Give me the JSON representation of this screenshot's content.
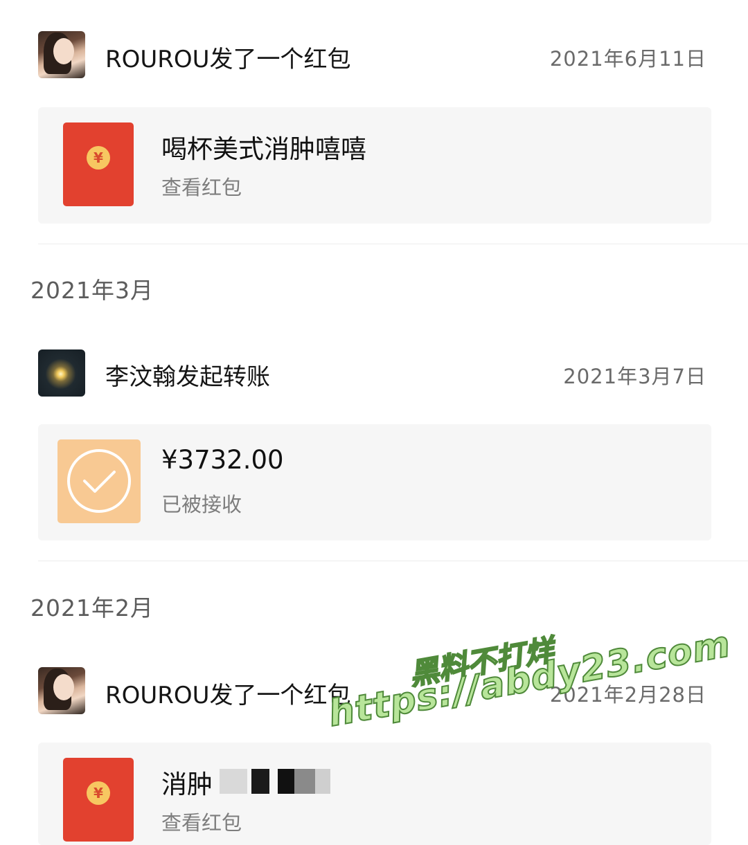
{
  "transactions": [
    {
      "sender": "ROUROU发了一个红包",
      "date": "2021年6月11日",
      "avatar": "female-portrait-avatar",
      "card_type": "red-packet",
      "card_title": "喝杯美式消肿嘻嘻",
      "card_subtitle": "查看红包"
    },
    {
      "sender": "李汶翰发起转账",
      "date": "2021年3月7日",
      "avatar": "night-sky-moon-avatar",
      "card_type": "transfer",
      "card_title": "¥3732.00",
      "card_subtitle": "已被接收"
    },
    {
      "sender": "ROUROU发了一个红包",
      "date": "2021年2月28日",
      "avatar": "female-portrait-avatar",
      "card_type": "red-packet",
      "card_title": "消肿",
      "card_subtitle": "查看红包"
    }
  ],
  "month_headers": [
    "2021年3月",
    "2021年2月"
  ],
  "red_packet_symbol": "¥",
  "watermark": {
    "line1": "黑料不打烊",
    "line2": "https://abdy23.com"
  },
  "colors": {
    "red_packet": "#e2412f",
    "coin": "#f7c761",
    "transfer_done": "#f8c993",
    "card_bg": "#f6f6f6"
  }
}
